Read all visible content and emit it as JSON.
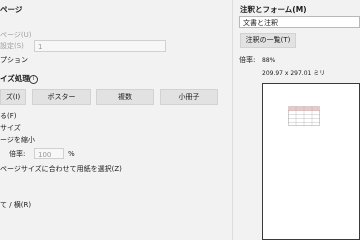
{
  "left": {
    "page_section": "ページ",
    "page_range_label": "ページ(U)",
    "custom_label": "設定(S)",
    "custom_value": "1",
    "options_label": "プション",
    "size_section": "イズ処理",
    "info_icon": "info-icon",
    "mode_buttons": [
      "ズ(I)",
      "ポスター",
      "複数",
      "小冊子"
    ],
    "fit_label": "る(F)",
    "actual_label": "サイズ",
    "shrink_label": "ージを縮小",
    "scale_label": "倍率:",
    "scale_value": "100",
    "scale_unit": "%",
    "paper_choice_label": "ページサイズに合わせて用紙を選択(Z)",
    "orientation_label": "て / 横(R)"
  },
  "right": {
    "comments_label": "注釈とフォーム(M)",
    "comments_value": "文書と注釈",
    "summary_button": "注釈の一覧(T)",
    "zoom_label": "倍率:",
    "zoom_value": "88%",
    "page_size": "209.97 x 297.01 ミリ"
  }
}
